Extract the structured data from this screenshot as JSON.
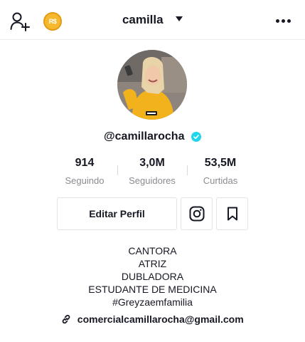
{
  "header": {
    "username": "camilla",
    "coin_label": "R$"
  },
  "profile": {
    "handle": "@camillarocha",
    "verified": true
  },
  "stats": [
    {
      "value": "914",
      "label": "Seguindo"
    },
    {
      "value": "3,0M",
      "label": "Seguidores"
    },
    {
      "value": "53,5M",
      "label": "Curtidas"
    }
  ],
  "actions": {
    "edit_label": "Editar Perfil",
    "instagram_icon": "instagram-icon",
    "bookmark_icon": "bookmark-icon"
  },
  "bio": {
    "lines": [
      "CANTORA",
      "ATRIZ",
      "DUBLADORA",
      "ESTUDANTE DE MEDICINA",
      "#Greyzaemfamilia"
    ]
  },
  "link": {
    "text": "comercialcamillarocha@gmail.com"
  },
  "colors": {
    "text": "#161823",
    "secondary": "#8a8b91",
    "verified": "#20d5ec",
    "coin": "#f5b82e",
    "border": "#e3e3e4"
  }
}
